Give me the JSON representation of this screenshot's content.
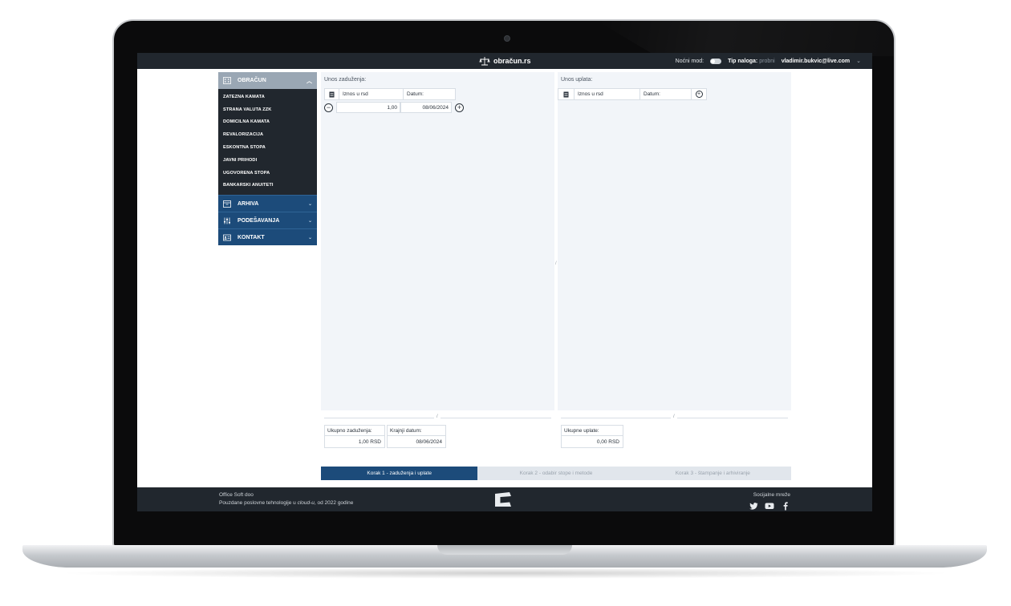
{
  "topbar": {
    "brand": "obračun.rs",
    "night_mode_label": "Noćni mod:",
    "account_type_label": "Tip naloga:",
    "account_type_value": "probni",
    "user_email": "vladimir.bukvic@live.com"
  },
  "sidebar": {
    "header": "OBRAČUN",
    "items": [
      {
        "label": "ZATEZNA KAMATA"
      },
      {
        "label": "STRANA VALUTA ZZK"
      },
      {
        "label": "DOMICILNA KAMATA"
      },
      {
        "label": "REVALORIZACIJA"
      },
      {
        "label": "ESKONTNA STOPA"
      },
      {
        "label": "JAVNI PRIHODI"
      },
      {
        "label": "UGOVORENA STOPA"
      },
      {
        "label": "BANKARSKI ANUITETI"
      }
    ],
    "sections": [
      {
        "label": "ARHIVA"
      },
      {
        "label": "PODEŠAVANJA"
      },
      {
        "label": "KONTAKT"
      }
    ]
  },
  "debits": {
    "title": "Unos zaduženja:",
    "col_amount": "Iznos u rsd",
    "col_date": "Datum:",
    "row": {
      "amount": "1,00",
      "date": "08/06/2024"
    },
    "total_label": "Ukupno zaduženja:",
    "total_value": "1,00 RSD",
    "end_date_label": "Krajnji datum:",
    "end_date_value": "08/06/2024"
  },
  "payments": {
    "title": "Unos uplata:",
    "col_amount": "Iznos u rsd",
    "col_date": "Datum:",
    "total_label": "Ukupne uplate:",
    "total_value": "0,00 RSD"
  },
  "divider_symbol": "/",
  "steps": [
    {
      "label": "Korak 1 - zaduženja i uplate"
    },
    {
      "label": "Korak 2 - odabir stope i metode"
    },
    {
      "label": "Korak 3 - štampanje i arhiviranje"
    }
  ],
  "footer": {
    "company": "Office Soft doo",
    "tagline_prefix": "Pouzdane poslovne tehnologije u ",
    "tagline_em": "cloud-u",
    "tagline_suffix": ", od 2022 godine",
    "social_label": "Socijalne mreže"
  },
  "colors": {
    "topbar": "#21272e",
    "accent": "#1c4b7a",
    "sidebar_head": "#9aa7b4",
    "panel_bg": "#f2f5f9"
  }
}
